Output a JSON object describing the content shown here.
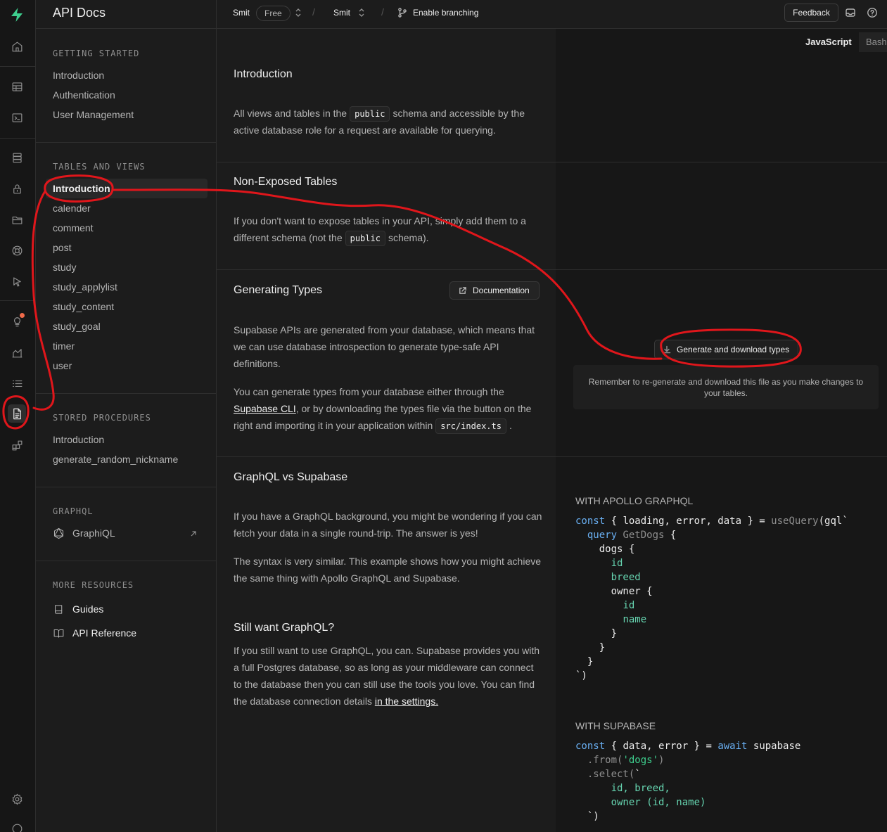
{
  "rail": {
    "active": "api-docs-icon"
  },
  "menu": {
    "title": "API Docs",
    "sections": [
      {
        "title": "GETTING STARTED",
        "items": [
          "Introduction",
          "Authentication",
          "User Management"
        ]
      },
      {
        "title": "TABLES AND VIEWS",
        "items": [
          "Introduction",
          "calender",
          "comment",
          "post",
          "study",
          "study_applylist",
          "study_content",
          "study_goal",
          "timer",
          "user"
        ],
        "active_item": "Introduction"
      },
      {
        "title": "STORED PROCEDURES",
        "items": [
          "Introduction",
          "generate_random_nickname"
        ]
      },
      {
        "title": "GRAPHQL",
        "items": [
          "GraphiQL"
        ]
      },
      {
        "title": "MORE RESOURCES",
        "items": [
          "Guides",
          "API Reference"
        ]
      }
    ]
  },
  "topbar": {
    "org": "Smit",
    "plan_badge": "Free",
    "project": "Smit",
    "branching": "Enable branching",
    "feedback": "Feedback"
  },
  "content": {
    "introduction": {
      "title": "Introduction",
      "p1_a": "All views and tables in the",
      "p1_code": "public",
      "p1_b": "schema and accessible by the active database role for a request are available for querying."
    },
    "non_exposed": {
      "title": "Non-Exposed Tables",
      "p1_a": "If you don't want to expose tables in your API, simply add them to a different schema (not the",
      "p1_code": "public",
      "p1_b": "schema)."
    },
    "generating_types": {
      "title": "Generating Types",
      "doc_button": "Documentation",
      "p1": "Supabase APIs are generated from your database, which means that we can use database introspection to generate type-safe API definitions.",
      "p2_a": "You can generate types from your database either through the",
      "p2_link": "Supabase CLI",
      "p2_b": ", or by downloading the types file via the button on the right and importing it in your application within",
      "p2_code": "src/index.ts",
      "p2_c": "."
    },
    "graphql_vs": {
      "title": "GraphQL vs Supabase",
      "p1": "If you have a GraphQL background, you might be wondering if you can fetch your data in a single round-trip. The answer is yes!",
      "p2": "The syntax is very similar. This example shows how you might achieve the same thing with Apollo GraphQL and Supabase."
    },
    "still_want": {
      "title": "Still want GraphQL?",
      "p1_a": "If you still want to use GraphQL, you can. Supabase provides you with a full Postgres database, so as long as your middleware can connect to the database then you can still use the tools you love. You can find the database connection details",
      "p1_link": "in the settings.",
      "p1_b": ""
    }
  },
  "right": {
    "lang_tabs": [
      "JavaScript",
      "Bash"
    ],
    "active_lang": "JavaScript",
    "gen_button": "Generate and download types",
    "remember": "Remember to re-generate and download this file as you make changes to your tables.",
    "apollo_label": "WITH APOLLO GRAPHQL",
    "supabase_label": "WITH SUPABASE"
  },
  "colors": {
    "brand": "#3ecf8e",
    "annotation": "#e0161b"
  }
}
